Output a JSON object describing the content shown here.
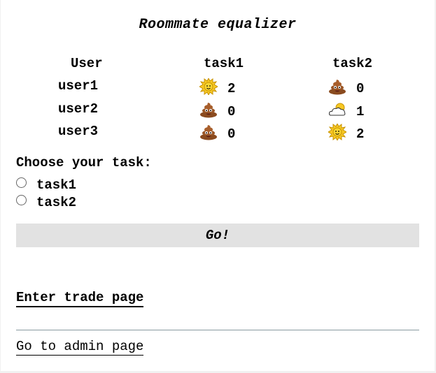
{
  "title": "Roommate equalizer",
  "table": {
    "headers": [
      "User",
      "task1",
      "task2"
    ],
    "rows": [
      {
        "user": "user1",
        "task1": {
          "icon": "sun-icon",
          "value": "2"
        },
        "task2": {
          "icon": "poop-icon",
          "value": "0"
        }
      },
      {
        "user": "user2",
        "task1": {
          "icon": "poop-icon",
          "value": "0"
        },
        "task2": {
          "icon": "cloud-sun-icon",
          "value": "1"
        }
      },
      {
        "user": "user3",
        "task1": {
          "icon": "poop-icon",
          "value": "0"
        },
        "task2": {
          "icon": "sun-icon",
          "value": "2"
        }
      }
    ]
  },
  "form": {
    "prompt": "Choose your task:",
    "options": [
      "task1",
      "task2"
    ],
    "submit_label": "Go!"
  },
  "links": {
    "trade": "Enter trade page",
    "admin": "Go to admin page"
  },
  "colors": {
    "card_bg": "#ffffff",
    "page_bg": "#f1f1f1",
    "button_bg": "#e2e2e2",
    "divider": "#8899a0"
  }
}
